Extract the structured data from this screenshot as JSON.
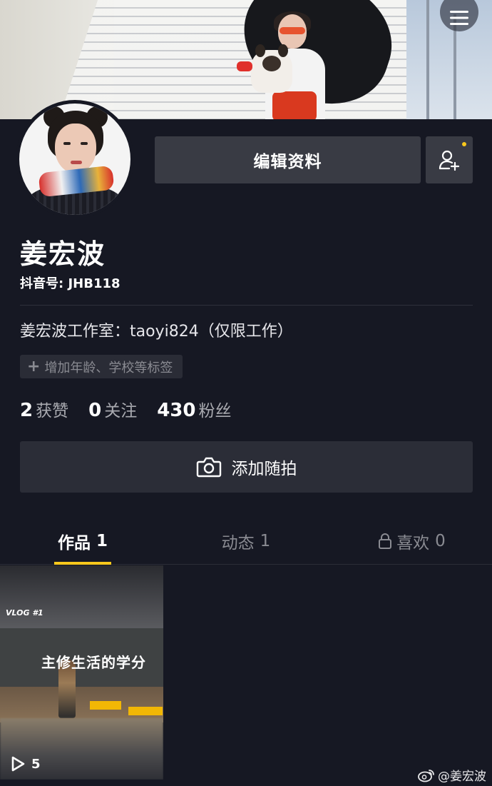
{
  "profile": {
    "name": "姜宏波",
    "douyin_id": "抖音号: JHB118",
    "bio": "姜宏波工作室：taoyi824（仅限工作）",
    "add_tag_label": "增加年龄、学校等标签"
  },
  "actions": {
    "edit_profile_label": "编辑资料",
    "add_friend_icon": "add-friend-icon",
    "add_snapshot_label": "添加随拍"
  },
  "stats": [
    {
      "value": "2",
      "label": "获赞"
    },
    {
      "value": "0",
      "label": "关注"
    },
    {
      "value": "430",
      "label": "粉丝"
    }
  ],
  "tabs": [
    {
      "label": "作品",
      "count": "1",
      "active": true
    },
    {
      "label": "动态",
      "count": "1",
      "active": false
    },
    {
      "label": "喜欢",
      "count": "0",
      "active": false,
      "locked": true
    }
  ],
  "videos": [
    {
      "play_count": "5",
      "overlay_tag": "VLOG #1",
      "board_text": "主修生活的学分"
    }
  ],
  "watermark": "@姜宏波",
  "colors": {
    "background": "#161823",
    "button": "#393b44",
    "accent": "#f8c81c",
    "muted_text": "#8a8b92"
  }
}
